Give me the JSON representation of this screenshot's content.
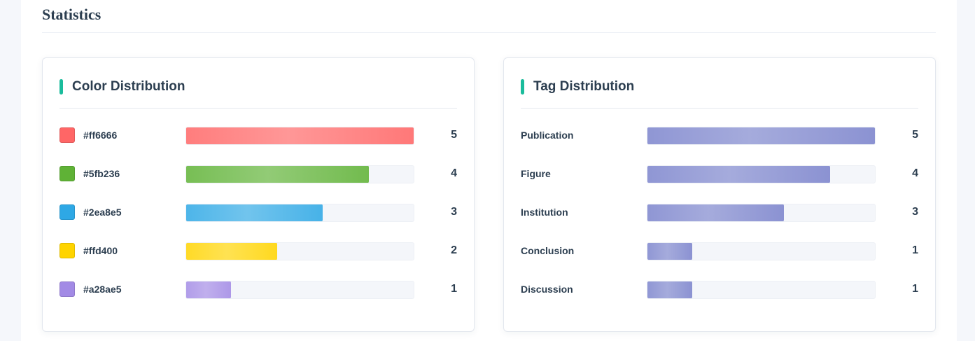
{
  "section": {
    "title": "Statistics"
  },
  "color_card": {
    "title": "Color Distribution",
    "items": [
      {
        "label": "#ff6666",
        "count": "5",
        "value": 5,
        "color": "#ff6666"
      },
      {
        "label": "#5fb236",
        "count": "4",
        "value": 4,
        "color": "#5fb236"
      },
      {
        "label": "#2ea8e5",
        "count": "3",
        "value": 3,
        "color": "#2ea8e5"
      },
      {
        "label": "#ffd400",
        "count": "2",
        "value": 2,
        "color": "#ffd400"
      },
      {
        "label": "#a28ae5",
        "count": "1",
        "value": 1,
        "color": "#a28ae5"
      }
    ]
  },
  "tag_card": {
    "title": "Tag Distribution",
    "bar_color": "#7b83cc",
    "items": [
      {
        "label": "Publication",
        "count": "5",
        "value": 5
      },
      {
        "label": "Figure",
        "count": "4",
        "value": 4
      },
      {
        "label": "Institution",
        "count": "3",
        "value": 3
      },
      {
        "label": "Conclusion",
        "count": "1",
        "value": 1
      },
      {
        "label": "Discussion",
        "count": "1",
        "value": 1
      }
    ]
  },
  "colors": {
    "accent": "#1abc9c",
    "text": "#2c3e50",
    "track": "#f4f6fa"
  }
}
